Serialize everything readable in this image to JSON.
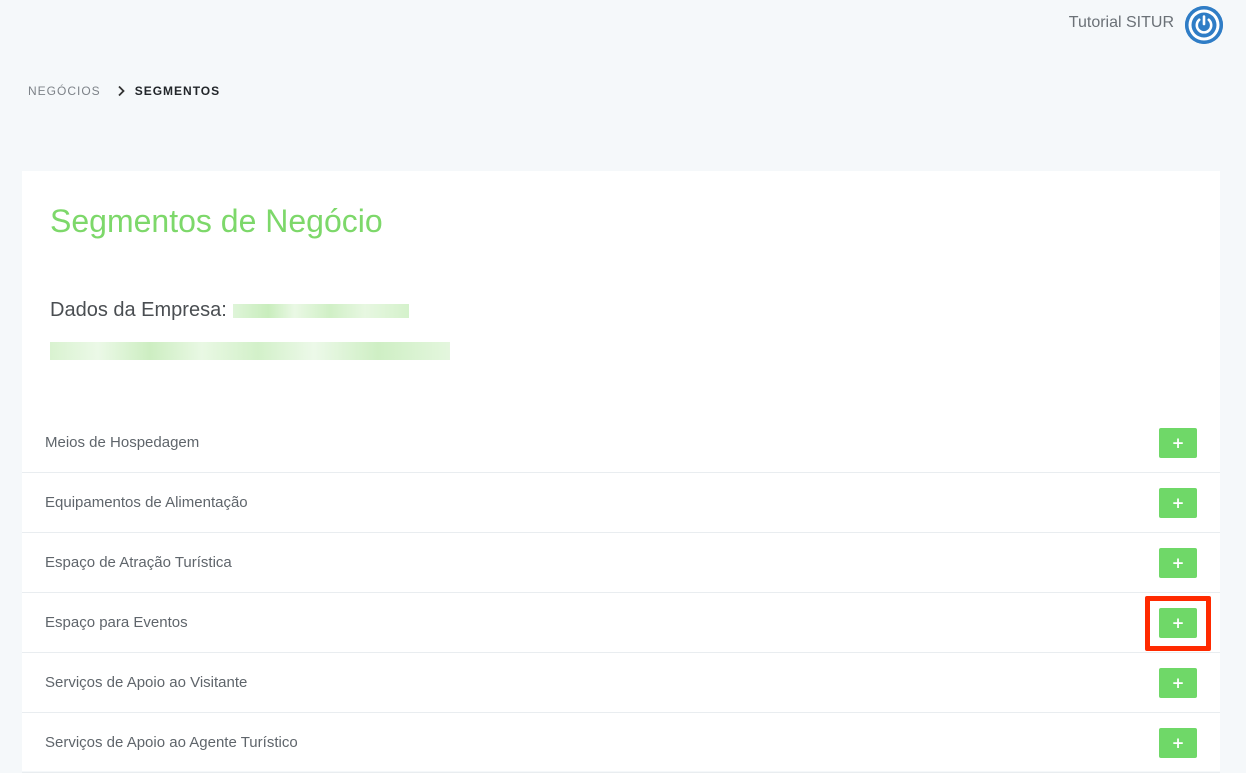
{
  "header": {
    "user_name": "Tutorial SITUR",
    "power_icon": "power-icon",
    "power_color": "#2f7dc6"
  },
  "breadcrumb": {
    "parent": "NEGÓCIOS",
    "separator_icon": "chevron-right-icon",
    "current": "SEGMENTOS"
  },
  "main": {
    "title": "Segmentos de Negócio",
    "title_color": "#7dd86a",
    "company_label": "Dados da Empresa:"
  },
  "segments": [
    {
      "label": "Meios de Hospedagem",
      "button_label": "+"
    },
    {
      "label": "Equipamentos de Alimentação",
      "button_label": "+"
    },
    {
      "label": "Espaço de Atração Turística",
      "button_label": "+"
    },
    {
      "label": "Espaço para Eventos",
      "button_label": "+",
      "highlighted": true
    },
    {
      "label": "Serviços de Apoio ao Visitante",
      "button_label": "+"
    },
    {
      "label": "Serviços de Apoio ao Agente Turístico",
      "button_label": "+"
    }
  ],
  "colors": {
    "add_button": "#6fd868",
    "highlight": "#ff2a00",
    "background": "#f5f8fa"
  }
}
